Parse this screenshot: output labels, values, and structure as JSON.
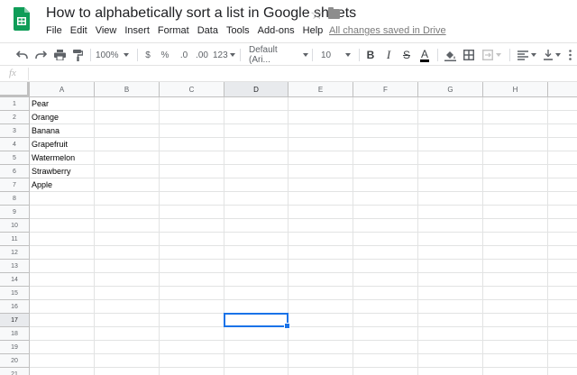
{
  "app": {
    "document_title": "How to alphabetically sort a list in Google sheets",
    "save_status": "All changes saved in Drive",
    "brand_color": "#0f9d58"
  },
  "menu": [
    "File",
    "Edit",
    "View",
    "Insert",
    "Format",
    "Data",
    "Tools",
    "Add-ons",
    "Help"
  ],
  "toolbar": {
    "zoom": "100%",
    "currency": "$",
    "percent": "%",
    "decrease_decimal": ".0",
    "increase_decimal": ".00",
    "more_formats": "123",
    "font": "Default (Ari...",
    "font_size": "10",
    "bold": "B",
    "italic": "I",
    "strikethrough": "S",
    "text_color": "A",
    "icons": [
      "undo-icon",
      "redo-icon",
      "print-icon",
      "paint-format-icon",
      "fill-color-icon",
      "borders-icon",
      "merge-cells-icon",
      "align-left-icon",
      "valign-bottom-icon",
      "more-icon"
    ]
  },
  "formula_bar": {
    "label": "fx",
    "value": ""
  },
  "sheet": {
    "columns": [
      "A",
      "B",
      "C",
      "D",
      "E",
      "F",
      "G",
      "H"
    ],
    "rows": [
      "1",
      "2",
      "3",
      "4",
      "5",
      "6",
      "7",
      "8",
      "9",
      "10",
      "11",
      "12",
      "13",
      "14",
      "15",
      "16",
      "17",
      "18",
      "19",
      "20",
      "21"
    ],
    "column_a_values": [
      "Pear",
      "Orange",
      "Banana",
      "Grapefruit",
      "Watermelon",
      "Strawberry",
      "Apple"
    ],
    "selected_column": "D",
    "selected_row": "17",
    "selection_color": "#1a73e8"
  }
}
